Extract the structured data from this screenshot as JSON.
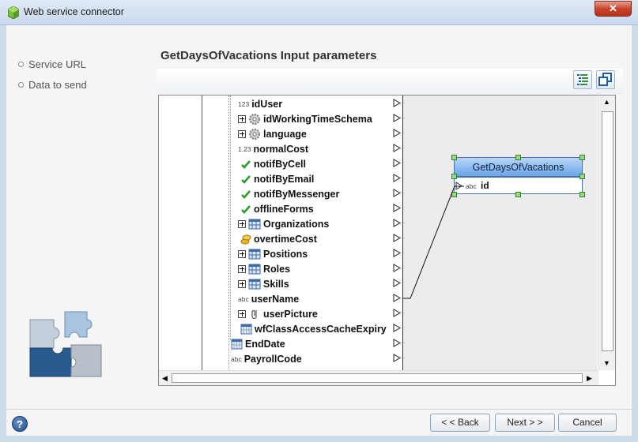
{
  "window": {
    "title": "Web service connector",
    "close_label": "✕"
  },
  "nav": {
    "items": [
      {
        "label": "Service URL"
      },
      {
        "label": "Data to send"
      }
    ]
  },
  "main": {
    "heading": "GetDaysOfVacations Input parameters"
  },
  "tree": {
    "rows": [
      {
        "type_label": "123",
        "label": "idUser",
        "icon": "number-icon"
      },
      {
        "label": "idWorkingTimeSchema",
        "icon": "gear-icon",
        "expandable": true
      },
      {
        "label": "language",
        "icon": "gear-icon",
        "expandable": true
      },
      {
        "type_label": "1.23",
        "label": "normalCost",
        "icon": "decimal-icon"
      },
      {
        "label": "notifByCell",
        "icon": "checkmark-icon"
      },
      {
        "label": "notifByEmail",
        "icon": "checkmark-icon"
      },
      {
        "label": "notifByMessenger",
        "icon": "checkmark-icon"
      },
      {
        "label": "offlineForms",
        "icon": "checkmark-icon"
      },
      {
        "label": "Organizations",
        "icon": "table-icon",
        "expandable": true
      },
      {
        "label": "overtimeCost",
        "icon": "coins-icon"
      },
      {
        "label": "Positions",
        "icon": "table-icon",
        "expandable": true
      },
      {
        "label": "Roles",
        "icon": "table-icon",
        "expandable": true
      },
      {
        "label": "Skills",
        "icon": "table-icon",
        "expandable": true
      },
      {
        "type_label": "abc",
        "label": "userName",
        "icon": "text-icon"
      },
      {
        "label": "userPicture",
        "icon": "paperclip-icon",
        "expandable": true
      },
      {
        "label": "wfClassAccessCacheExpiry",
        "icon": "calendar-icon"
      },
      {
        "label": "EndDate",
        "icon": "calendar-icon"
      },
      {
        "type_label": "abc",
        "label": "PayrollCode",
        "icon": "text-icon"
      }
    ]
  },
  "node": {
    "title": "GetDaysOfVacations",
    "field_type": "abc",
    "field_name": "id"
  },
  "footer": {
    "back_label": "< < Back",
    "next_label": "Next > >",
    "cancel_label": "Cancel",
    "help_label": "?"
  },
  "colors": {
    "node_header": "#6aa5e8",
    "handle": "#8fe07a",
    "check": "#2a9a2a"
  }
}
